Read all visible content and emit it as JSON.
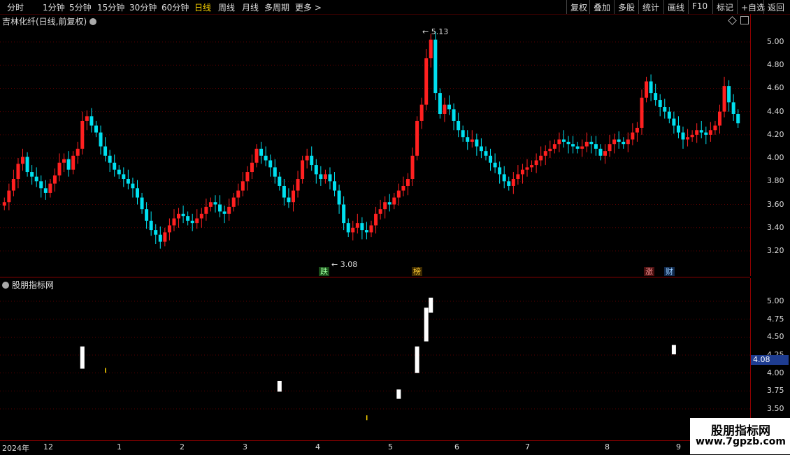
{
  "toolbar": {
    "periods": [
      "分时",
      "1分钟",
      "5分钟",
      "15分钟",
      "30分钟",
      "60分钟",
      "日线",
      "周线",
      "月线",
      "多周期",
      "更多"
    ],
    "active_period": "日线",
    "more_arrow": ">",
    "actions": [
      "复权",
      "叠加",
      "多股",
      "统计",
      "画线",
      "F10",
      "标记",
      "+自选",
      "返回"
    ]
  },
  "main_panel": {
    "title": "吉林化纤(日线,前复权)",
    "price_labels": [
      "5.00",
      "4.80",
      "4.60",
      "4.40",
      "4.20",
      "4.00",
      "3.80",
      "3.60",
      "3.40",
      "3.20"
    ],
    "high_annotation": "5.13",
    "low_annotation": "3.08",
    "badges": [
      {
        "text": "跌",
        "color": "#2e8b2e"
      },
      {
        "text": "榜",
        "color": "#cc7a00"
      },
      {
        "text": "涨",
        "color": "#b22222"
      },
      {
        "text": "财",
        "color": "#2266aa"
      }
    ]
  },
  "indicator_panel": {
    "title": "股朋指标网",
    "axis_labels": [
      "5.00",
      "4.75",
      "4.50",
      "4.25",
      "4.00",
      "3.75",
      "3.50"
    ],
    "current_value": "4.08"
  },
  "date_axis": {
    "labels": [
      "2024年",
      "12",
      "1",
      "2",
      "3",
      "4",
      "5",
      "6",
      "7",
      "8",
      "9"
    ]
  },
  "watermark": {
    "line1": "股朋指标网",
    "line2": "www.7gpzb.com"
  },
  "colors": {
    "up": "#ff2020",
    "down": "#00e0f0",
    "axis": "#8b0000",
    "active": "#ffd700"
  },
  "chart_data": {
    "type": "candlestick",
    "ylim": [
      3.05,
      5.15
    ],
    "high": 5.13,
    "low": 3.08,
    "closes": [
      3.62,
      3.72,
      3.82,
      3.95,
      4.01,
      3.88,
      3.84,
      3.8,
      3.74,
      3.7,
      3.78,
      3.85,
      3.96,
      3.99,
      3.9,
      4.02,
      4.08,
      4.32,
      4.36,
      4.28,
      4.22,
      4.1,
      4.02,
      3.96,
      3.9,
      3.86,
      3.82,
      3.78,
      3.74,
      3.66,
      3.56,
      3.46,
      3.38,
      3.34,
      3.28,
      3.36,
      3.42,
      3.48,
      3.52,
      3.5,
      3.46,
      3.44,
      3.48,
      3.52,
      3.58,
      3.62,
      3.6,
      3.54,
      3.52,
      3.58,
      3.66,
      3.72,
      3.8,
      3.88,
      3.96,
      4.08,
      4.02,
      3.98,
      3.92,
      3.84,
      3.76,
      3.66,
      3.62,
      3.72,
      3.82,
      3.98,
      4.02,
      3.94,
      3.86,
      3.82,
      3.86,
      3.8,
      3.72,
      3.6,
      3.44,
      3.36,
      3.4,
      3.44,
      3.38,
      3.36,
      3.42,
      3.52,
      3.56,
      3.62,
      3.6,
      3.66,
      3.72,
      3.76,
      3.82,
      4.02,
      4.32,
      4.46,
      4.86,
      5.02,
      4.56,
      4.38,
      4.46,
      4.42,
      4.32,
      4.24,
      4.18,
      4.14,
      4.16,
      4.1,
      4.06,
      4.02,
      3.96,
      3.92,
      3.86,
      3.8,
      3.76,
      3.82,
      3.86,
      3.9,
      3.92,
      3.94,
      3.98,
      4.02,
      4.06,
      4.08,
      4.12,
      4.16,
      4.14,
      4.12,
      4.1,
      4.08,
      4.1,
      4.14,
      4.12,
      4.08,
      4.02,
      4.06,
      4.12,
      4.16,
      4.14,
      4.12,
      4.16,
      4.22,
      4.26,
      4.52,
      4.66,
      4.56,
      4.5,
      4.44,
      4.4,
      4.34,
      4.28,
      4.22,
      4.16,
      4.18,
      4.2,
      4.24,
      4.22,
      4.2,
      4.24,
      4.28,
      4.4,
      4.62,
      4.48,
      4.38,
      4.3
    ]
  }
}
